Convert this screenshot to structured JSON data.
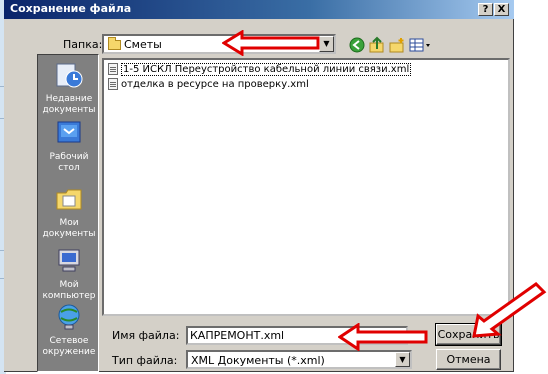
{
  "dialog": {
    "title": "Сохранение файла",
    "help_button": "?",
    "close_button": "X"
  },
  "look_in": {
    "label": "Папка:",
    "value": "Сметы",
    "dropdown_icon": "chevron-down-icon"
  },
  "toolbar": {
    "icons": [
      "back-icon",
      "up-folder-icon",
      "new-folder-icon",
      "view-menu-icon"
    ]
  },
  "places": [
    {
      "label": "Недавние документы",
      "icon": "recent-documents-icon"
    },
    {
      "label": "Рабочий стол",
      "icon": "desktop-icon"
    },
    {
      "label": "Мои документы",
      "icon": "my-documents-icon"
    },
    {
      "label": "Мой компьютер",
      "icon": "my-computer-icon"
    },
    {
      "label": "Сетевое окружение",
      "icon": "network-icon"
    }
  ],
  "files": [
    {
      "name": "1-5 ИСКЛ Переустройство кабельной линии связи.xml",
      "selected": true
    },
    {
      "name": "отделка в ресурсе на проверку.xml",
      "selected": false
    }
  ],
  "filename": {
    "label": "Имя файла:",
    "value": "КАПРЕМОНТ.xml"
  },
  "filetype": {
    "label": "Тип файла:",
    "value": "XML Документы (*.xml)"
  },
  "buttons": {
    "save": "Сохранить",
    "cancel": "Отмена"
  },
  "colors": {
    "title_bar": "#0a246a",
    "dialog_face": "#d4d0c8",
    "places_bar": "#808080",
    "annotation_arrow": "#e00000"
  }
}
